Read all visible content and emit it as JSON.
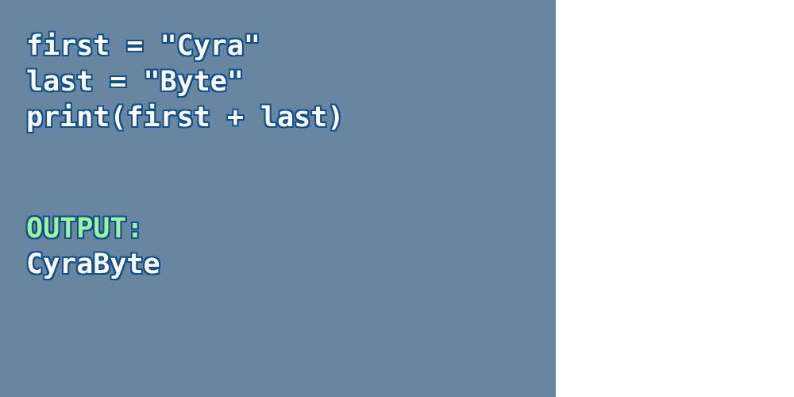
{
  "code": {
    "lines": [
      "first = \"Cyra\"",
      "last = \"Byte\"",
      "print(first + last)"
    ]
  },
  "output": {
    "label": "OUTPUT:",
    "value": "CyraByte"
  },
  "colors": {
    "panel_background": "#68869f",
    "code_text": "#ffffff",
    "output_label": "#9cf59a",
    "text_outline": "#0f4f8f",
    "page_background": "#ffffff"
  }
}
